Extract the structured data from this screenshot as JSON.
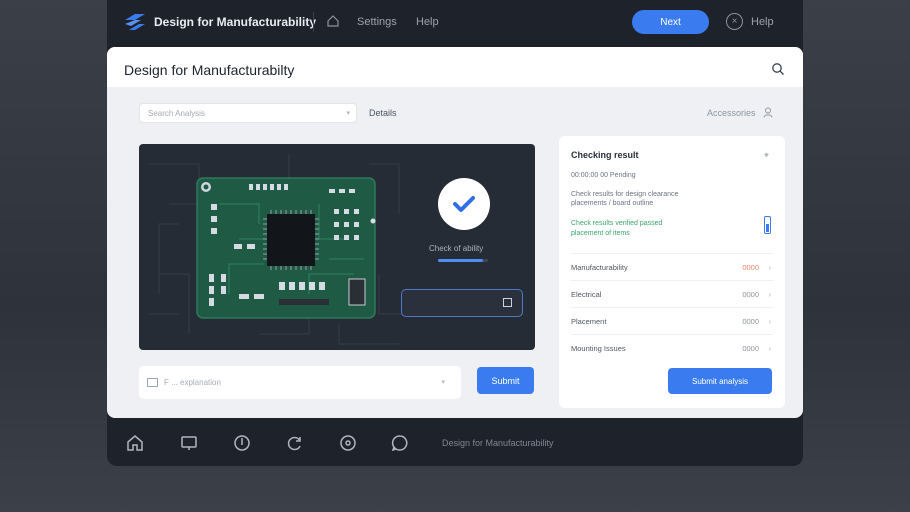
{
  "app": {
    "title": "Design for Manufacturability",
    "nav": {
      "settings": "Settings",
      "help": "Help",
      "help_right": "Help"
    },
    "primary_button": "Next"
  },
  "panel": {
    "title": "Design for Manufacturabilty",
    "search_placeholder": "Search  Analysis",
    "breadcrumb": "Details",
    "accounts": "Accessories"
  },
  "viewer": {
    "status_text": "Check of ability",
    "progress": 0.9
  },
  "comment": {
    "placeholder": "F ... explanation",
    "submit": "Submit"
  },
  "card": {
    "title": "Checking result",
    "lines": [
      "00:00:00    00 Pending",
      "Check results  for design clearance",
      "placements / board outline",
      "Check results verified passed",
      "placement  of items"
    ],
    "rows": [
      {
        "label": "Manufacturability",
        "value": "0000",
        "warn": true
      },
      {
        "label": "Electrical",
        "value": "0000",
        "warn": false
      },
      {
        "label": "Placement",
        "value": "0000",
        "warn": false
      },
      {
        "label": "Mounting Issues",
        "value": "0000",
        "warn": false
      }
    ],
    "button": "Submit analysis"
  },
  "bottombar": {
    "label": "Design for Manufacturability"
  },
  "colors": {
    "accent": "#3a7cf0",
    "pcb": "#1f5a44",
    "success": "#3aa56b"
  }
}
